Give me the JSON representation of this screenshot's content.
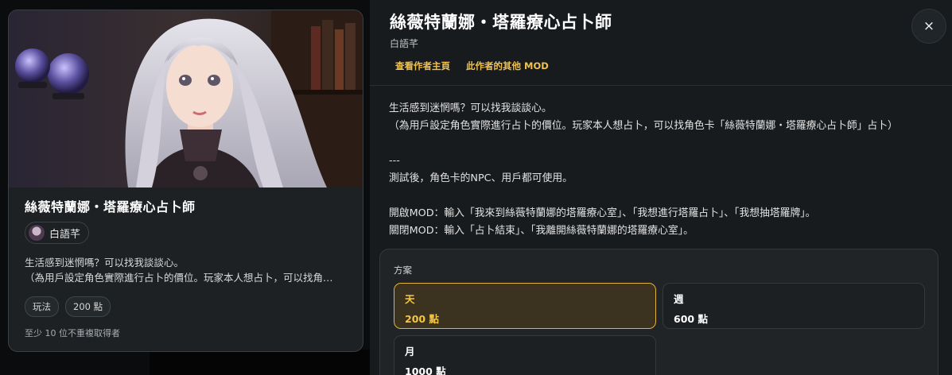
{
  "card": {
    "title": "絲薇特蘭娜・塔羅療心占卜師",
    "author": "白語芊",
    "desc_line1": "生活感到迷惘嗎？可以找我談談心。",
    "desc_line2": "（為用戶設定角色實際進行占卜的價位。玩家本人想占卜，可以找角…",
    "tags": [
      "玩法",
      "200 點"
    ],
    "note": "至少 10 位不重複取得者"
  },
  "panel": {
    "title": "絲薇特蘭娜・塔羅療心占卜師",
    "author": "白語芊",
    "link_author": "查看作者主頁",
    "link_mods": "此作者的其他 MOD",
    "close": "×",
    "description": "生活感到迷惘嗎？可以找我談談心。\n（為用戶設定角色實際進行占卜的價位。玩家本人想占卜，可以找角色卡「絲薇特蘭娜・塔羅療心占卜師」占卜）\n\n---\n測試後，角色卡的NPC、用戶都可使用。\n\n開啟MOD：輸入「我來到絲薇特蘭娜的塔羅療心室」、「我想進行塔羅占卜」、「我想抽塔羅牌」。\n關閉MOD：輸入「占卜結束」、「我離開絲薇特蘭娜的塔羅療心室」。"
  },
  "plans": {
    "label": "方案",
    "options": [
      {
        "name": "天",
        "price": "200 點",
        "selected": true
      },
      {
        "name": "週",
        "price": "600 點",
        "selected": false
      },
      {
        "name": "月",
        "price": "1000 點",
        "selected": false
      }
    ]
  },
  "colors": {
    "accent": "#f2c14b",
    "selected_border": "#e3b33a",
    "panel_bg": "#181b1e"
  }
}
